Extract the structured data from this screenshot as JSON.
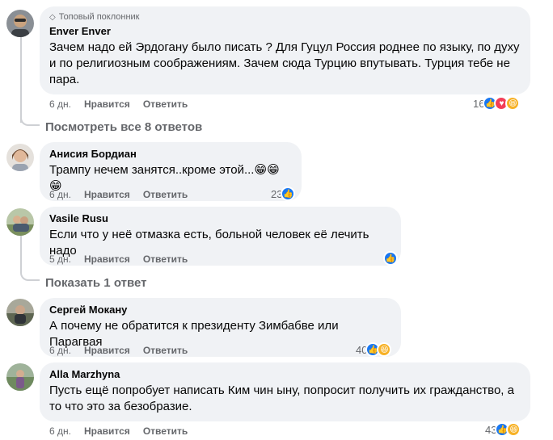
{
  "colors": {
    "like": "#1877f2",
    "love": "#f33e58",
    "haha": "#f7b125",
    "bubble": "#f0f2f5",
    "meta": "#65676b"
  },
  "comments": [
    {
      "badge": "Топовый поклонник",
      "author": "Enver Enver",
      "text": "Зачем надо ей Эрдогану было писать ? Для Гуцул Россия роднее по языку, по духу и по религиозным соображениям. Зачем сюда Турцию впутывать. Турция тебе не пара.",
      "time": "6 дн.",
      "like": "Нравится",
      "reply": "Ответить",
      "reactions_count": "16",
      "reactions": [
        "like-icon",
        "love-icon",
        "haha-icon"
      ],
      "replies_link": "Посмотреть все 8 ответов"
    },
    {
      "author": "Анисия Бордиан",
      "text": "Трампу нечем занятся..кроме этой...😁😁😁",
      "time": "6 дн.",
      "like": "Нравится",
      "reply": "Ответить",
      "reactions_count": "23",
      "reactions": [
        "like-icon"
      ]
    },
    {
      "author": "Vasile Rusu",
      "text": "Если что у неё отмазка есть, больной человек её лечить надо",
      "time": "5 дн.",
      "like": "Нравится",
      "reply": "Ответить",
      "reactions_count": "",
      "reactions": [
        "like-icon"
      ],
      "replies_link": "Показать 1 ответ"
    },
    {
      "author": "Сергей Мокану",
      "text": "А почему не обратится к президенту Зимбабве или Парагвая",
      "time": "6 дн.",
      "like": "Нравится",
      "reply": "Ответить",
      "reactions_count": "40",
      "reactions": [
        "like-icon",
        "haha-icon"
      ]
    },
    {
      "author": "Alla Marzhyna",
      "text": "Пусть ещё попробует написать Ким чин ыну, попросит получить их гражданство, а то что это за безобразие.",
      "time": "6 дн.",
      "like": "Нравится",
      "reply": "Ответить",
      "reactions_count": "43",
      "reactions": [
        "like-icon",
        "haha-icon"
      ]
    }
  ]
}
